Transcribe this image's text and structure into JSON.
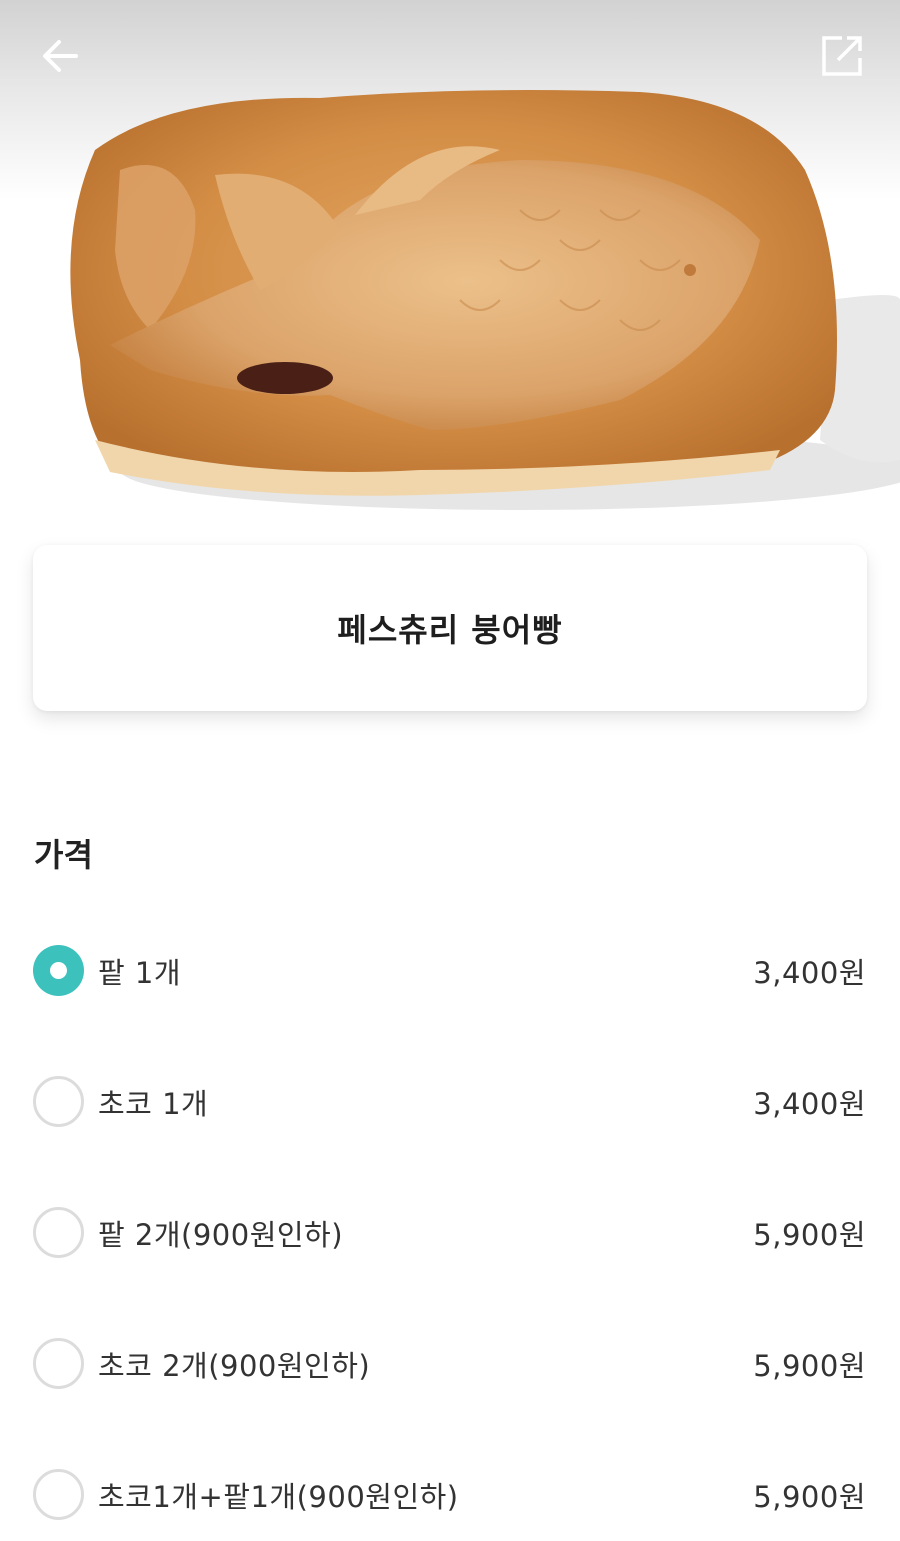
{
  "header": {
    "back_icon": "arrow-left-icon",
    "share_icon": "share-external-icon"
  },
  "product": {
    "image_subject": "pastry bungeoppang",
    "name": "페스츄리 붕어빵"
  },
  "price_section": {
    "title": "가격",
    "options": [
      {
        "label": "팥 1개",
        "price": "3,400원",
        "selected": true
      },
      {
        "label": "초코 1개",
        "price": "3,400원",
        "selected": false
      },
      {
        "label": "팥 2개(900원인하)",
        "price": "5,900원",
        "selected": false
      },
      {
        "label": "초코 2개(900원인하)",
        "price": "5,900원",
        "selected": false
      },
      {
        "label": "초코1개+팥1개(900원인하)",
        "price": "5,900원",
        "selected": false
      }
    ]
  },
  "colors": {
    "accent": "#3cc1bd",
    "radio_border": "#dcdcdc"
  }
}
